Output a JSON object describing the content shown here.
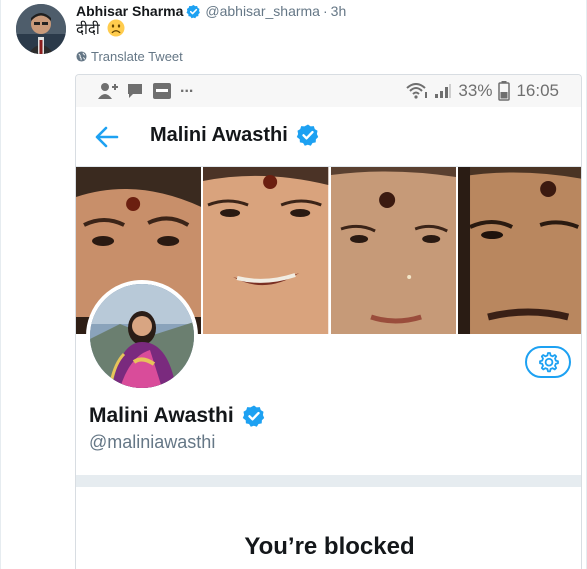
{
  "tweet": {
    "display_name": "Abhisar Sharma",
    "handle": "@abhisar_sharma",
    "separator": "·",
    "time": "3h",
    "text": "दीदी",
    "emoji_icon": "slightly-frowning-face-icon",
    "translate_label": "Translate Tweet"
  },
  "screenshot": {
    "status_bar": {
      "dots": "...",
      "battery": "33%",
      "time": "16:05"
    },
    "app_bar": {
      "title": "Malini Awasthi"
    },
    "profile": {
      "name": "Malini Awasthi",
      "handle": "@maliniawasthi"
    },
    "blocked_title": "You’re blocked"
  },
  "colors": {
    "twitter_blue": "#1da1f2",
    "text_primary": "#14171a",
    "text_secondary": "#657786",
    "divider": "#e6ecf0"
  }
}
